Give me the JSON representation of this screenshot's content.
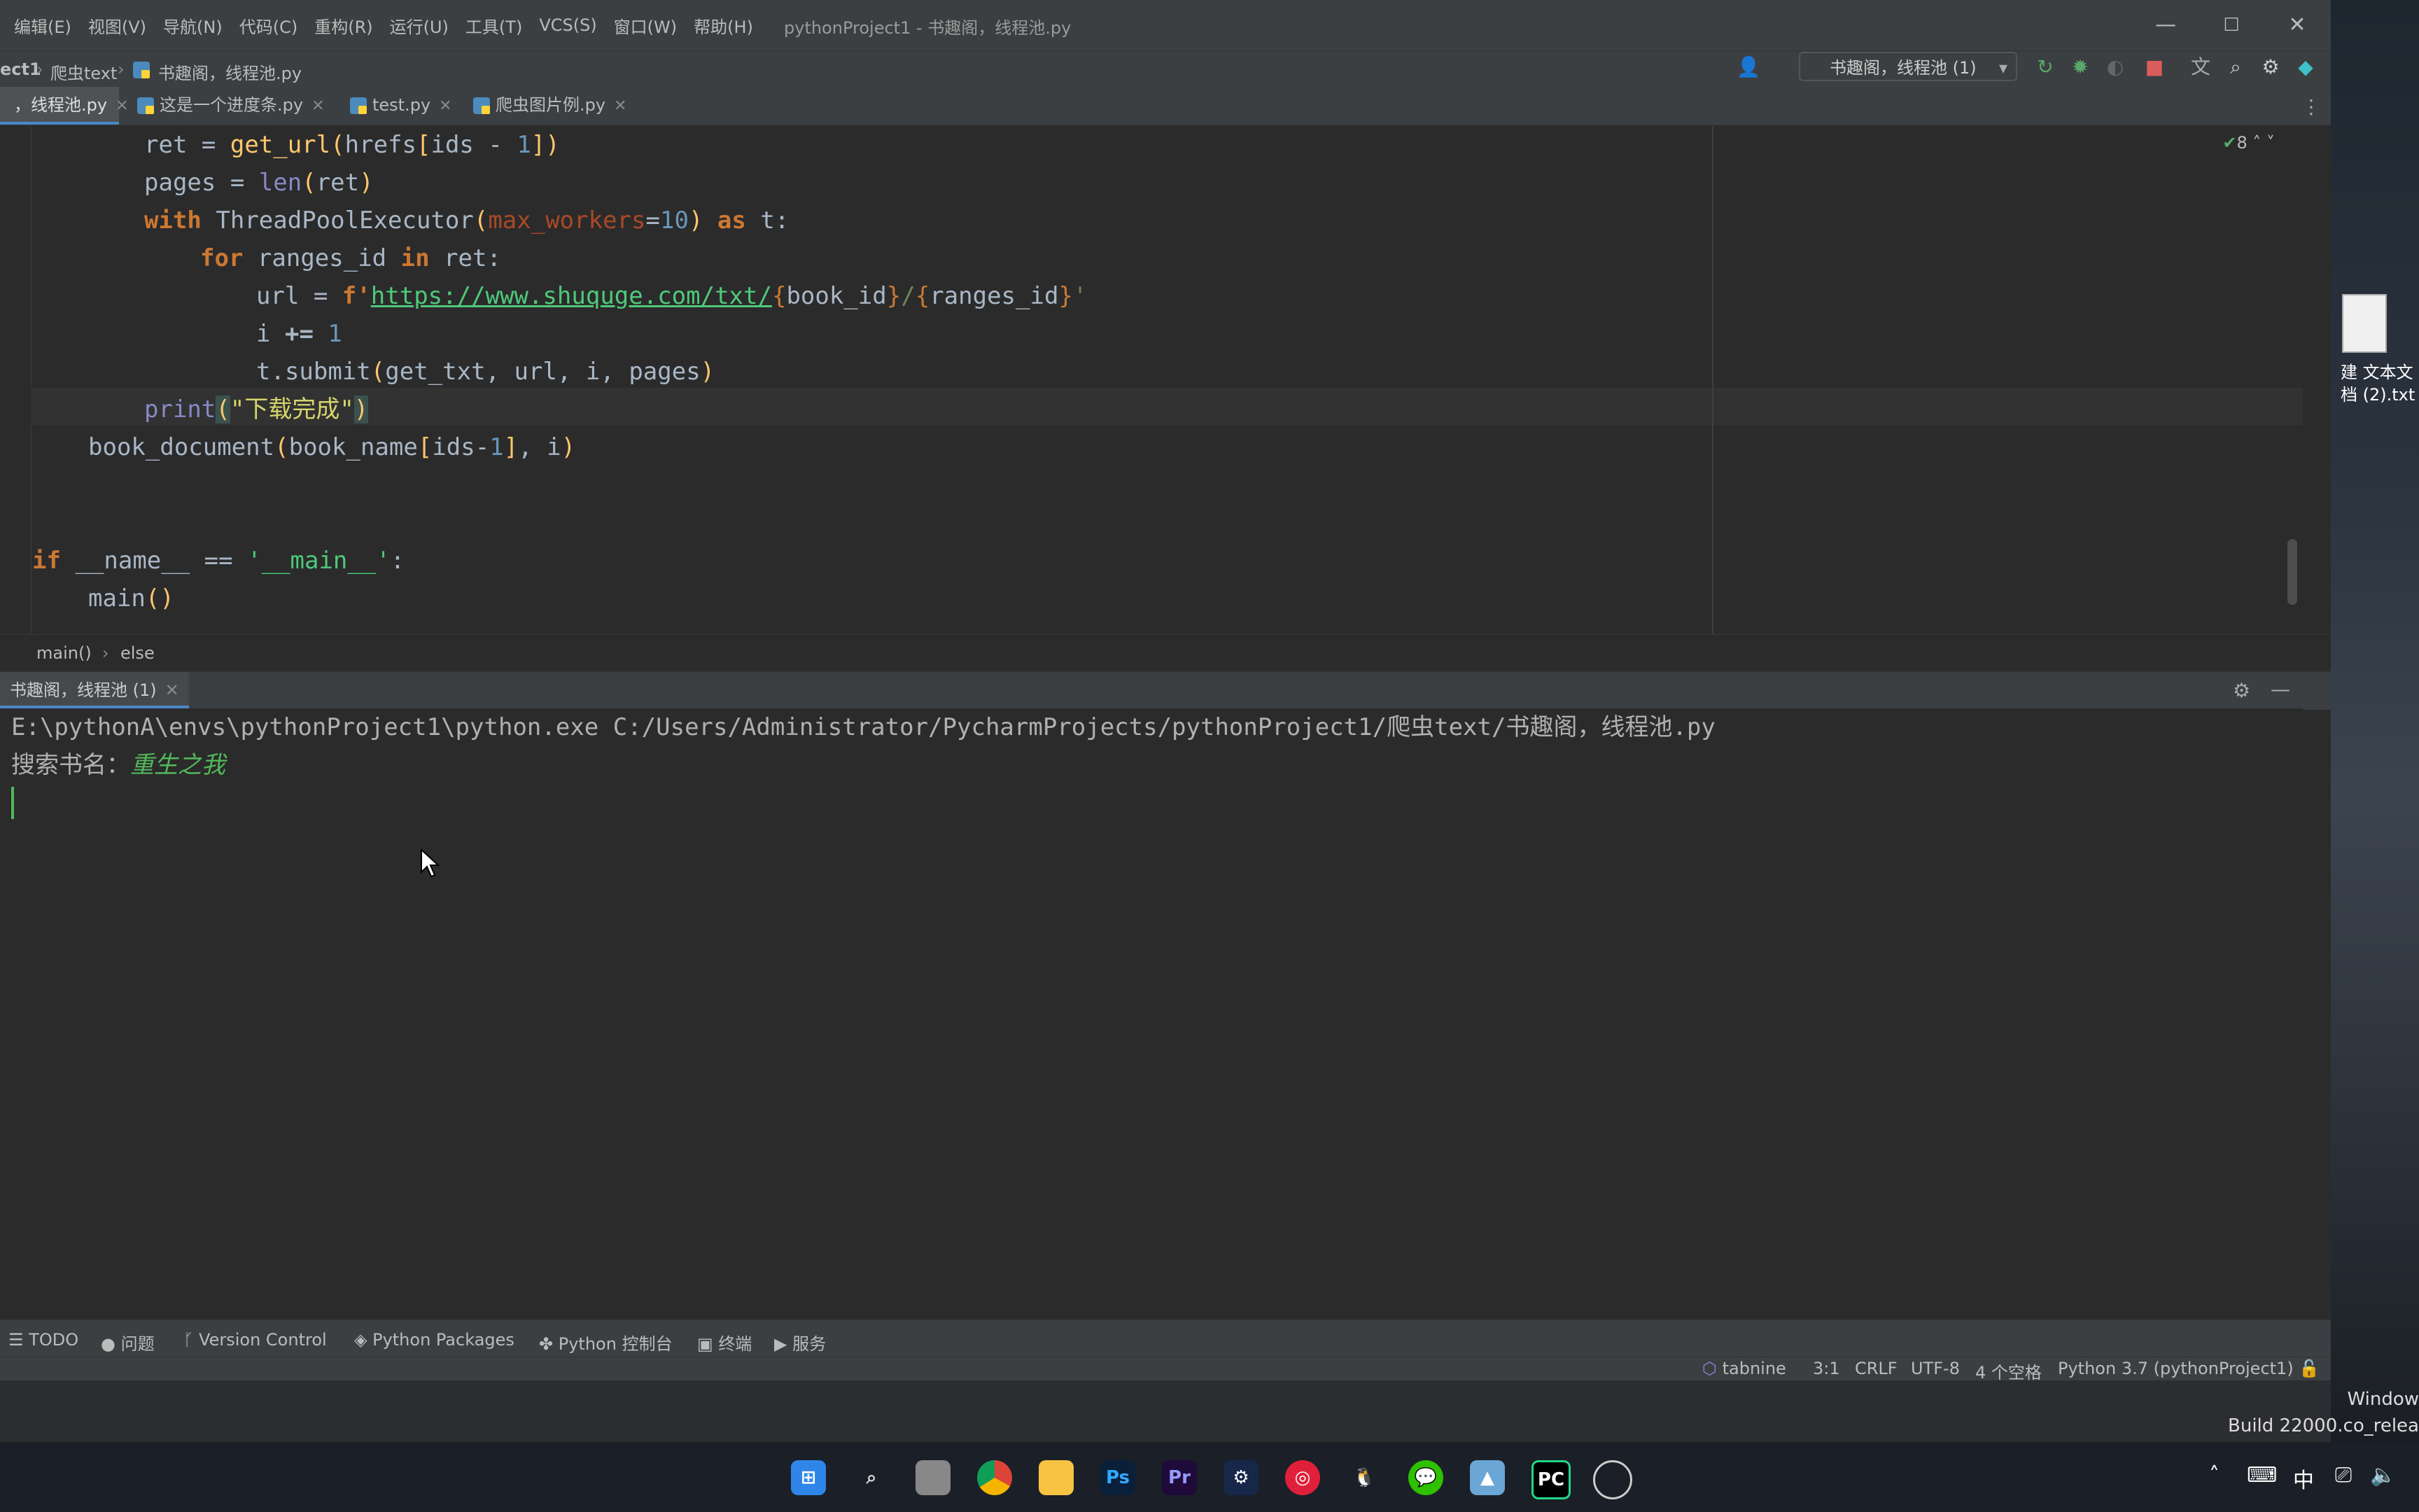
{
  "menu": [
    "编辑(E)",
    "视图(V)",
    "导航(N)",
    "代码(C)",
    "重构(R)",
    "运行(U)",
    "工具(T)",
    "VCS(S)",
    "窗口(W)",
    "帮助(H)"
  ],
  "window_title": "pythonProject1 - 书趣阁，线程池.py",
  "window_controls": {
    "minimize": "—",
    "maximize": "☐",
    "close": "✕"
  },
  "breadcrumbs": [
    "ect1",
    "爬虫text",
    "书趣阁，线程池.py"
  ],
  "run_config": "书趣阁，线程池 (1)",
  "tabs": [
    {
      "label": "，线程池.py",
      "active": true
    },
    {
      "label": "这是一个进度条.py",
      "active": false
    },
    {
      "label": "test.py",
      "active": false
    },
    {
      "label": "爬虫图片例.py",
      "active": false
    }
  ],
  "inspection_count": "8",
  "code": {
    "l1": {
      "a": "ret",
      "b": "get_url",
      "c": "hrefs",
      "d": "ids",
      "e": "1"
    },
    "l2": {
      "a": "pages",
      "b": "len",
      "c": "ret"
    },
    "l3": {
      "kw1": "with",
      "a": "ThreadPoolExecutor",
      "p": "max_workers",
      "n": "10",
      "kw2": "as",
      "b": "t"
    },
    "l4": {
      "kw1": "for",
      "a": "ranges_id",
      "kw2": "in",
      "b": "ret"
    },
    "l5": {
      "a": "url",
      "f": "f'",
      "u": "https://www.shuquge.com/txt/",
      "v1": "book_id",
      "v2": "ranges_id",
      "end": "'"
    },
    "l6": {
      "a": "i",
      "n": "1"
    },
    "l7": {
      "a": "t.submit",
      "b": "get_txt",
      "c": "url",
      "d": "i",
      "e": "pages"
    },
    "l8": {
      "a": "print",
      "s": "\"下载完成\""
    },
    "l9": {
      "a": "book_document",
      "b": "book_name",
      "c": "ids",
      "n": "1",
      "d": "i"
    },
    "l10": {
      "kw": "if",
      "a": "__name__",
      "s": "'__main__'"
    },
    "l11": {
      "a": "main"
    }
  },
  "editor_breadcrumb": [
    "main()",
    "else"
  ],
  "run_tab": "书趣阁，线程池 (1)",
  "console": {
    "cmd": "E:\\pythonA\\envs\\pythonProject1\\python.exe C:/Users/Administrator/PycharmProjects/pythonProject1/爬虫text/书趣阁，线程池.py",
    "prompt": "搜索书名：",
    "input": "重生之我"
  },
  "tools": [
    "TODO",
    "问题",
    "Version Control",
    "Python Packages",
    "Python 控制台",
    "终端",
    "服务"
  ],
  "status": {
    "tabnine": "tabnine",
    "pos": "3:1",
    "eol": "CRLF",
    "enc": "UTF-8",
    "indent": "4 个空格",
    "interp": "Python 3.7 (pythonProject1)"
  },
  "desktop": {
    "file_label": "建 文本文\n档 (2).txt"
  },
  "watermark": {
    "l1": "Window",
    "l2": "Build 22000.co_relea"
  },
  "taskbar": [
    "windows-start",
    "search",
    "task-view",
    "chrome",
    "explorer",
    "photoshop",
    "premiere",
    "steam",
    "netease-music",
    "qq",
    "wechat",
    "photos",
    "pycharm",
    "obs"
  ],
  "tray": {
    "ime": "中"
  }
}
